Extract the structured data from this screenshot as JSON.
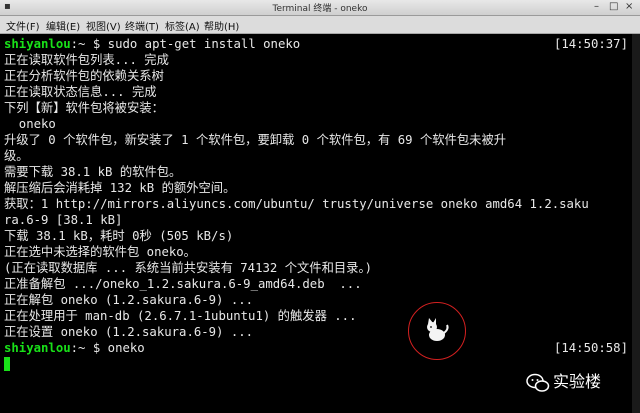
{
  "window": {
    "title": "Terminal 终端 - oneko"
  },
  "menu": [
    "文件(F)",
    "编辑(E)",
    "视图(V)",
    "终端(T)",
    "标签(A)",
    "帮助(H)"
  ],
  "terminal": {
    "prompt_user": "shiyanlou",
    "prompt_path": ":~ $",
    "cmd1": " sudo apt-get install oneko",
    "time1": "[14:50:37]",
    "out": [
      "正在读取软件包列表... 完成",
      "正在分析软件包的依赖关系树",
      "正在读取状态信息... 完成",
      "下列【新】软件包将被安装：",
      "  oneko",
      "升级了 0 个软件包，新安装了 1 个软件包，要卸载 0 个软件包，有 69 个软件包未被升",
      "级。",
      "需要下载 38.1 kB 的软件包。",
      "解压缩后会消耗掉 132 kB 的额外空间。",
      "获取：1 http://mirrors.aliyuncs.com/ubuntu/ trusty/universe oneko amd64 1.2.saku",
      "ra.6-9 [38.1 kB]",
      "下载 38.1 kB，耗时 0秒 (505 kB/s)",
      "正在选中未选择的软件包 oneko。",
      "(正在读取数据库 ... 系统当前共安装有 74132 个文件和目录。)",
      "正准备解包 .../oneko_1.2.sakura.6-9_amd64.deb  ...",
      "正在解包 oneko (1.2.sakura.6-9) ...",
      "正在处理用于 man-db (2.6.7.1-1ubuntu1) 的触发器 ...",
      "正在设置 oneko (1.2.sakura.6-9) ..."
    ],
    "cmd2": " oneko",
    "time2": "[14:50:58]"
  },
  "neko": {
    "icon": "cat-icon"
  },
  "watermark": {
    "text": "实验楼",
    "icon": "wechat-icon"
  }
}
